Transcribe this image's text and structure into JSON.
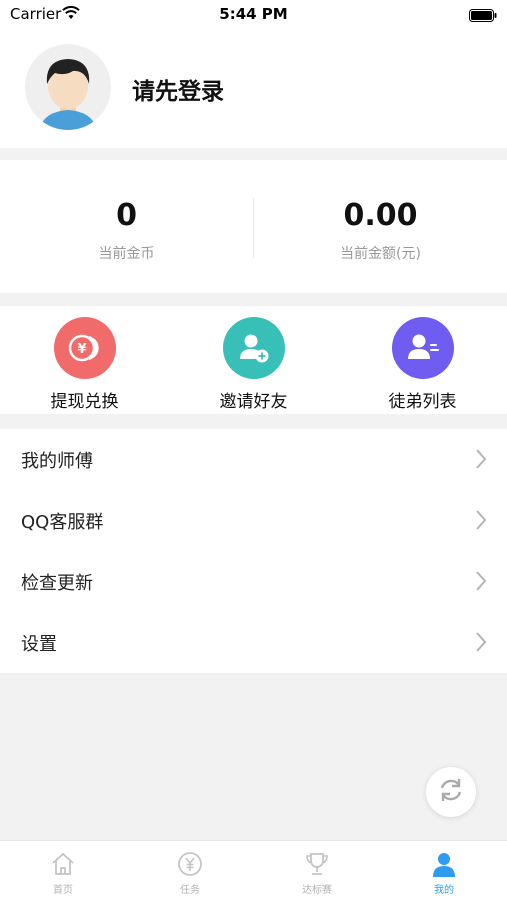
{
  "status_bar": {
    "carrier": "Carrier",
    "time": "5:44 PM"
  },
  "profile": {
    "login_prompt": "请先登录"
  },
  "stats": [
    {
      "value": "0",
      "label": "当前金币"
    },
    {
      "value": "0.00",
      "label": "当前金额(元)"
    }
  ],
  "actions": [
    {
      "label": "提现兑换",
      "icon": "coin-yen-icon",
      "color": "#f26b6b"
    },
    {
      "label": "邀请好友",
      "icon": "add-friend-icon",
      "color": "#37bfb8"
    },
    {
      "label": "徒弟列表",
      "icon": "apprentice-list-icon",
      "color": "#6f5cf0"
    }
  ],
  "menu": [
    {
      "label": "我的师傅"
    },
    {
      "label": "QQ客服群"
    },
    {
      "label": "检查更新"
    },
    {
      "label": "设置"
    }
  ],
  "tabbar": [
    {
      "label": "首页",
      "icon": "home-icon",
      "active": false
    },
    {
      "label": "任务",
      "icon": "yen-coin-icon",
      "active": false
    },
    {
      "label": "达标赛",
      "icon": "trophy-icon",
      "active": false
    },
    {
      "label": "我的",
      "icon": "user-icon",
      "active": true
    }
  ],
  "colors": {
    "accent": "#2f9cf0",
    "background": "#f2f2f2"
  }
}
